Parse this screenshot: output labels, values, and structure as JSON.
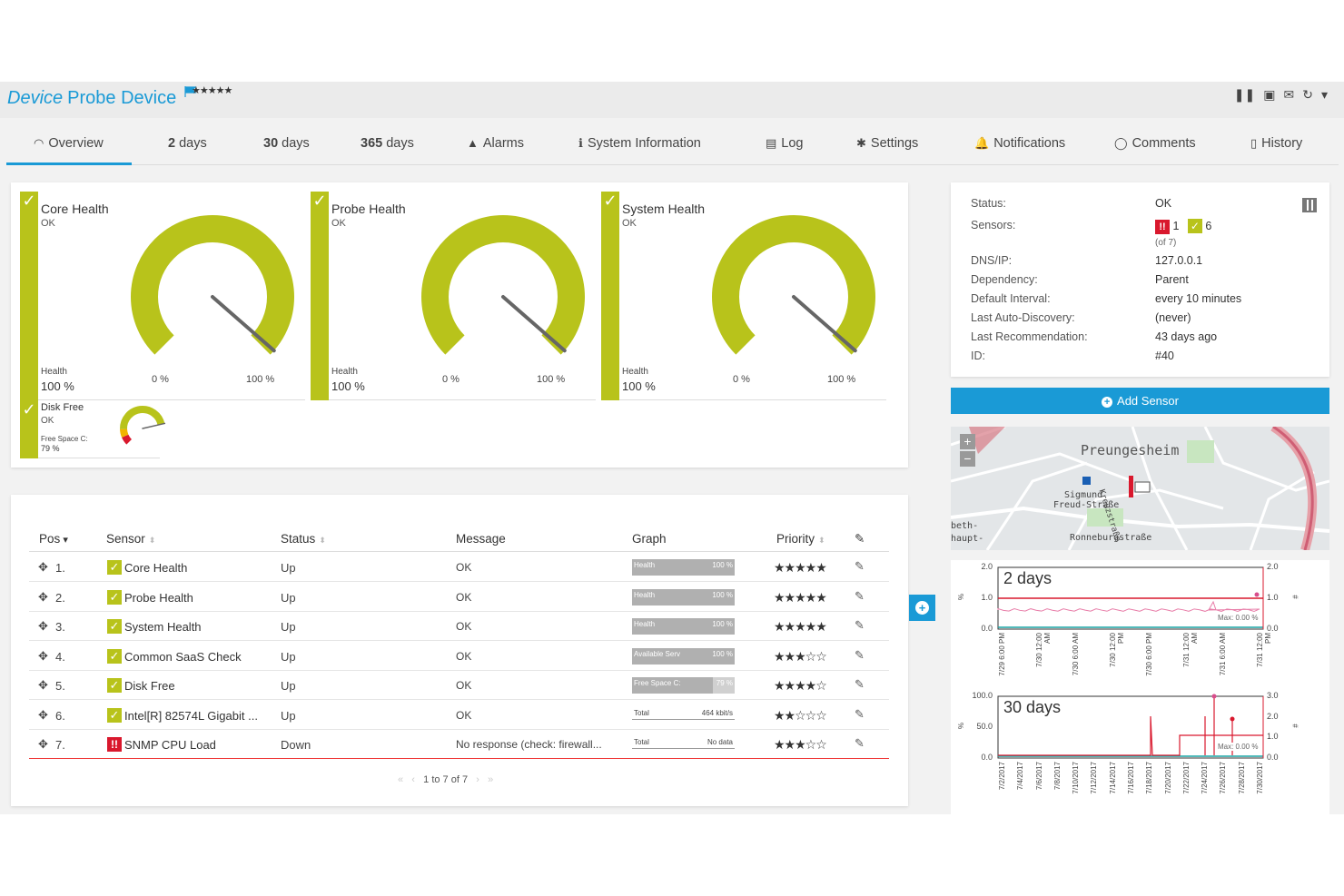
{
  "header": {
    "title_italic": "Device",
    "title_main": "Probe Device",
    "priority_stars": "★★★★★"
  },
  "tabs": [
    {
      "icon": "◠",
      "label": "Overview"
    },
    {
      "bold": "2",
      "label": "days"
    },
    {
      "bold": "30",
      "label": "days"
    },
    {
      "bold": "365",
      "label": "days"
    },
    {
      "icon": "▲",
      "label": "Alarms"
    },
    {
      "icon": "ℹ",
      "label": "System Information"
    },
    {
      "icon": "▤",
      "label": "Log"
    },
    {
      "icon": "✱",
      "label": "Settings"
    },
    {
      "icon": "🔔",
      "label": "Notifications"
    },
    {
      "icon": "◯",
      "label": "Comments"
    },
    {
      "icon": "▯",
      "label": "History"
    }
  ],
  "gauges": [
    {
      "name": "Core Health",
      "status": "OK",
      "channel": "Health",
      "value": "100 %",
      "min": "0 %",
      "max": "100 %",
      "level": 1.0
    },
    {
      "name": "Probe Health",
      "status": "OK",
      "channel": "Health",
      "value": "100 %",
      "min": "0 %",
      "max": "100 %",
      "level": 1.0
    },
    {
      "name": "System Health",
      "status": "OK",
      "channel": "Health",
      "value": "100 %",
      "min": "0 %",
      "max": "100 %",
      "level": 1.0
    }
  ],
  "disk_gauge": {
    "name": "Disk Free",
    "status": "OK",
    "channel": "Free Space C:",
    "value": "79 %",
    "level": 0.79
  },
  "device_info": {
    "labels": [
      "Status:",
      "Sensors:",
      "DNS/IP:",
      "Dependency:",
      "Default Interval:",
      "Last Auto-Discovery:",
      "Last Recommendation:",
      "ID:"
    ],
    "status": "OK",
    "sensors_down": "1",
    "sensors_up": "6",
    "sensors_total": "(of 7)",
    "dns": "127.0.0.1",
    "dependency": "Parent",
    "interval": "every 10 minutes",
    "auto_discovery": "(never)",
    "recommendation": "43 days ago",
    "id": "#40"
  },
  "add_sensor_label": "Add Sensor",
  "table": {
    "headers": {
      "pos": "Pos",
      "sensor": "Sensor",
      "status": "Status",
      "message": "Message",
      "graph": "Graph",
      "priority": "Priority"
    },
    "rows": [
      {
        "pos": "1.",
        "sensor": "Core Health",
        "status": "Up",
        "message": "OK",
        "graph_label": "Health",
        "graph_value": "100 %",
        "stars": "★★★★★",
        "down": false
      },
      {
        "pos": "2.",
        "sensor": "Probe Health",
        "status": "Up",
        "message": "OK",
        "graph_label": "Health",
        "graph_value": "100 %",
        "stars": "★★★★★",
        "down": false
      },
      {
        "pos": "3.",
        "sensor": "System Health",
        "status": "Up",
        "message": "OK",
        "graph_label": "Health",
        "graph_value": "100 %",
        "stars": "★★★★★",
        "down": false
      },
      {
        "pos": "4.",
        "sensor": "Common SaaS Check",
        "status": "Up",
        "message": "OK",
        "graph_label": "Available Serv",
        "graph_value": "100 %",
        "stars": "★★★☆☆",
        "down": false
      },
      {
        "pos": "5.",
        "sensor": "Disk Free",
        "status": "Up",
        "message": "OK",
        "graph_label": "Free Space C:",
        "graph_value": "79 %",
        "stars": "★★★★☆",
        "down": false
      },
      {
        "pos": "6.",
        "sensor": "Intel[R] 82574L Gigabit ...",
        "status": "Up",
        "message": "OK",
        "graph_label": "Total",
        "graph_value": "464 kbit/s",
        "stars": "★★☆☆☆",
        "down": false
      },
      {
        "pos": "7.",
        "sensor": "SNMP CPU Load",
        "status": "Down",
        "message": "No response (check: firewall...",
        "graph_label": "Total",
        "graph_value": "No data",
        "stars": "★★★☆☆",
        "down": true
      }
    ],
    "pager": "1 to 7 of 7"
  },
  "map": {
    "labels": [
      "Preungesheim",
      "Sigmund",
      "Freud-Straße",
      "Ronneburgstraße",
      "beth-",
      "haupt-",
      "Kreuzstraße"
    ],
    "zoom_in": "+",
    "zoom_out": "−"
  },
  "charts": [
    {
      "title": "2 days",
      "y_left": [
        "2.0",
        "1.0",
        "0.0"
      ],
      "y_right": [
        "2.0",
        "1.0",
        "0.0"
      ],
      "y_left_unit": "%",
      "y_right_unit": "#",
      "max_label": "Max: 0.00 %",
      "x_labels": [
        "7/29 6:00 PM",
        "7/30 12:00 AM",
        "7/30 6:00 AM",
        "7/30 12:00 PM",
        "7/30 6:00 PM",
        "7/31 12:00 AM",
        "7/31 6:00 AM",
        "7/31 12:00 PM"
      ]
    },
    {
      "title": "30 days",
      "y_left": [
        "100.0",
        "50.0",
        "0.0"
      ],
      "y_right": [
        "3.0",
        "2.0",
        "1.0",
        "0.0"
      ],
      "y_left_unit": "%",
      "y_right_unit": "#",
      "max_label": "Max: 0.00 %",
      "x_labels": [
        "7/2/2017",
        "7/4/2017",
        "7/6/2017",
        "7/8/2017",
        "7/10/2017",
        "7/12/2017",
        "7/14/2017",
        "7/16/2017",
        "7/18/2017",
        "7/20/2017",
        "7/22/2017",
        "7/24/2017",
        "7/26/2017",
        "7/28/2017",
        "7/30/2017"
      ]
    }
  ],
  "colors": {
    "accent": "#1a9ad6",
    "ok": "#b8c31b",
    "down": "#d9182d"
  }
}
